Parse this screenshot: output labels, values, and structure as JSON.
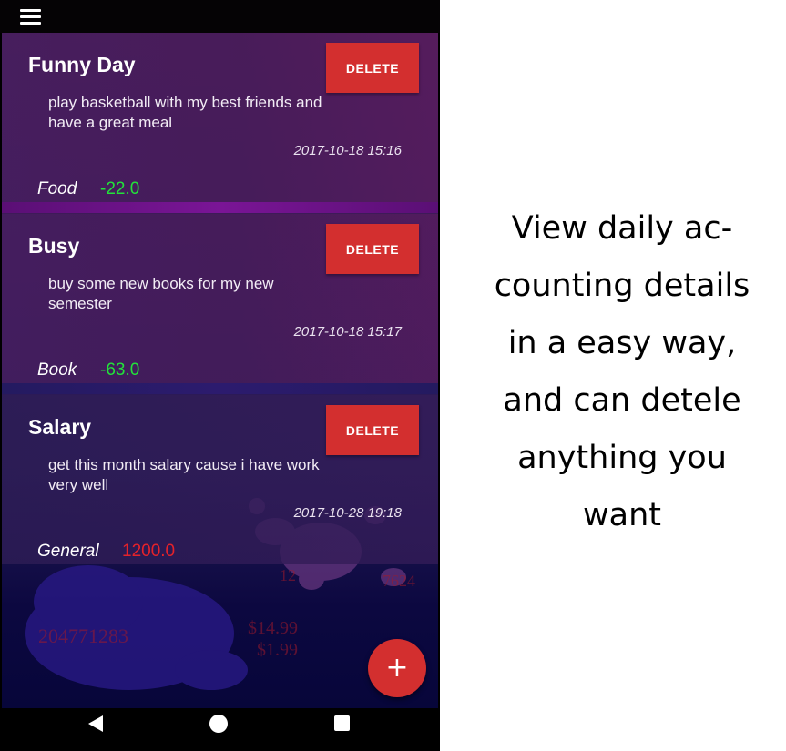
{
  "colors": {
    "delete_button": "#d32f2f",
    "fab": "#d32f2f",
    "expense_amount": "#22e23a",
    "income_amount": "#e5222a"
  },
  "toolbar": {
    "menu_icon": "hamburger-menu-icon"
  },
  "records": [
    {
      "title": "Funny Day",
      "delete_label": "DELETE",
      "description": "play basketball with my best friends and have a great meal",
      "timestamp": "2017-10-18 15:16",
      "category": "Food",
      "amount": "-22.0"
    },
    {
      "title": "Busy",
      "delete_label": "DELETE",
      "description": "buy some new books for my new semester",
      "timestamp": "2017-10-18 15:17",
      "category": "Book",
      "amount": "-63.0"
    },
    {
      "title": "Salary",
      "delete_label": "DELETE",
      "description": "get this month salary cause i have work very well",
      "timestamp": "2017-10-28 19:18",
      "category": "General",
      "amount": "1200.0"
    }
  ],
  "background_numbers": [
    "12",
    "7624",
    "204771283",
    "$14.99",
    "$1.99"
  ],
  "fab": {
    "label": "+",
    "icon": "plus-icon"
  },
  "navigation": {
    "back_icon": "back-triangle-icon",
    "home_icon": "home-circle-icon",
    "recents_icon": "recents-square-icon"
  },
  "caption": {
    "lines": [
      "View daily ac-",
      "counting details",
      "in a easy way,",
      "and can detele",
      "anything you",
      "want"
    ]
  }
}
